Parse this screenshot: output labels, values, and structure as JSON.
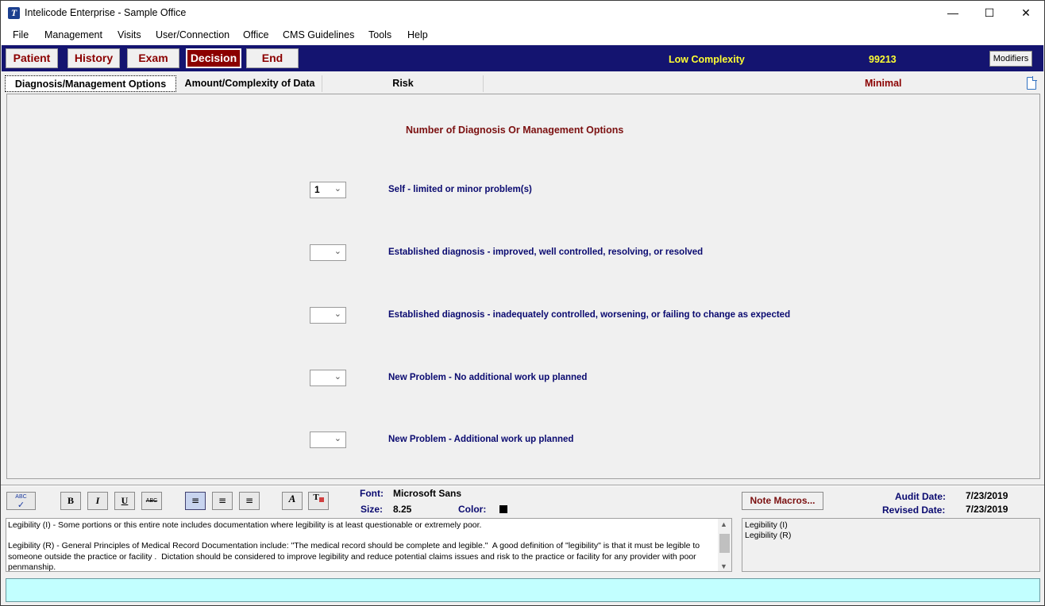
{
  "window": {
    "title": "Intelicode Enterprise - Sample Office",
    "app_icon_letter": "T",
    "minimize": "—",
    "maximize": "☐",
    "close": "✕"
  },
  "menu": [
    "File",
    "Management",
    "Visits",
    "User/Connection",
    "Office",
    "CMS Guidelines",
    "Tools",
    "Help"
  ],
  "nav": {
    "buttons": [
      "Patient",
      "History",
      "Exam",
      "Decision",
      "End"
    ],
    "active": "Decision",
    "complexity": "Low Complexity",
    "code": "99213",
    "modifiers": "Modifiers"
  },
  "tabs": {
    "items": [
      "Diagnosis/Management Options",
      "Amount/Complexity of Data",
      "Risk"
    ],
    "selected": "Diagnosis/Management Options",
    "risk_level": "Minimal"
  },
  "panel": {
    "title": "Number of Diagnosis Or Management Options",
    "options": [
      {
        "value": "1",
        "label": "Self - limited or minor problem(s)"
      },
      {
        "value": "",
        "label": "Established diagnosis - improved, well controlled, resolving, or resolved"
      },
      {
        "value": "",
        "label": "Established diagnosis - inadequately controlled, worsening, or failing to change as expected"
      },
      {
        "value": "",
        "label": "New Problem - No additional work up planned"
      },
      {
        "value": "",
        "label": "New Problem - Additional work up planned"
      }
    ]
  },
  "format": {
    "spell": "ABC",
    "bold": "B",
    "italic": "I",
    "underline": "U",
    "strike": "ABC",
    "font_label": "Font:",
    "font_value": "Microsoft Sans",
    "size_label": "Size:",
    "size_value": "8.25",
    "color_label": "Color:",
    "note_macros": "Note Macros...",
    "audit_label": "Audit Date:",
    "audit_value": "7/23/2019",
    "revised_label": "Revised Date:",
    "revised_value": "7/23/2019"
  },
  "note": {
    "text": "Legibility (I) - Some portions or this entire note includes documentation where legibility is at least questionable or extremely poor.\n\nLegibility (R) - General Principles of Medical Record Documentation include: \"The medical record should be complete and legible.\"  A good definition of \"legibility\" is that it must be legible to someone outside the practice or facility .  Dictation should be considered to improve legibility and reduce potential claims issues and risk to the practice or facility for any provider with poor penmanship."
  },
  "macros": [
    "Legibility (I)",
    "Legibility (R)"
  ]
}
